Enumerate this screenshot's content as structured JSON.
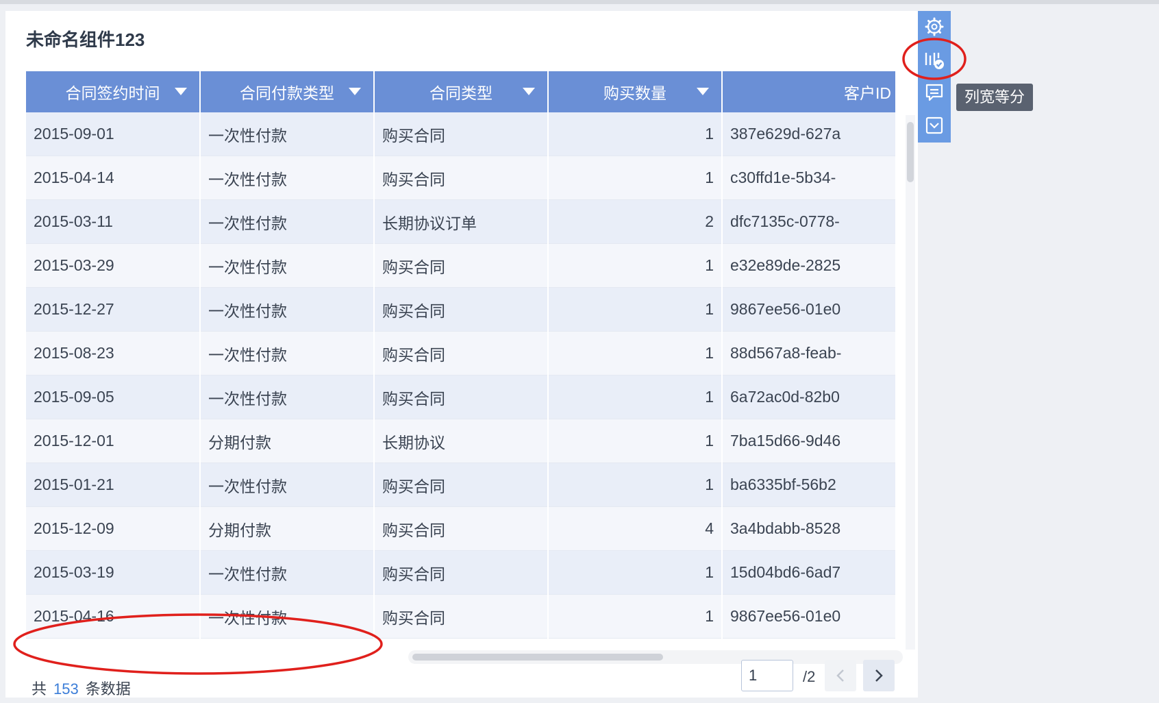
{
  "widget": {
    "title": "未命名组件123"
  },
  "table": {
    "columns": [
      "合同签约时间",
      "合同付款类型",
      "合同类型",
      "购买数量",
      "客户ID"
    ],
    "rows": [
      [
        "2015-09-01",
        "一次性付款",
        "购买合同",
        "1",
        "387e629d-627a"
      ],
      [
        "2015-04-14",
        "一次性付款",
        "购买合同",
        "1",
        "c30ffd1e-5b34-"
      ],
      [
        "2015-03-11",
        "一次性付款",
        "长期协议订单",
        "2",
        "dfc7135c-0778-"
      ],
      [
        "2015-03-29",
        "一次性付款",
        "购买合同",
        "1",
        "e32e89de-2825"
      ],
      [
        "2015-12-27",
        "一次性付款",
        "购买合同",
        "1",
        "9867ee56-01e0"
      ],
      [
        "2015-08-23",
        "一次性付款",
        "购买合同",
        "1",
        "88d567a8-feab-"
      ],
      [
        "2015-09-05",
        "一次性付款",
        "购买合同",
        "1",
        "6a72ac0d-82b0"
      ],
      [
        "2015-12-01",
        "分期付款",
        "长期协议",
        "1",
        "7ba15d66-9d46"
      ],
      [
        "2015-01-21",
        "一次性付款",
        "购买合同",
        "1",
        "ba6335bf-56b2"
      ],
      [
        "2015-12-09",
        "分期付款",
        "购买合同",
        "4",
        "3a4bdabb-8528"
      ],
      [
        "2015-03-19",
        "一次性付款",
        "购买合同",
        "1",
        "15d04bd6-6ad7"
      ],
      [
        "2015-04-16",
        "一次性付款",
        "购买合同",
        "1",
        "9867ee56-01e0"
      ]
    ]
  },
  "footer": {
    "count_prefix": "共",
    "count_value": "153",
    "count_suffix": "条数据",
    "page_input": "1",
    "page_total": "/2"
  },
  "toolbar": {
    "icons": [
      "settings-gear-icon",
      "column-width-equal-icon",
      "comment-icon",
      "collapse-down-icon"
    ],
    "tooltip": "列宽等分"
  },
  "colors": {
    "header_bg": "#6a8fd6",
    "row_odd": "#e9eef8",
    "row_even": "#f4f6fb",
    "toolbar_bg": "#6a9be3",
    "accent_number": "#3b7dd8",
    "annotation_red": "#e0201c"
  }
}
